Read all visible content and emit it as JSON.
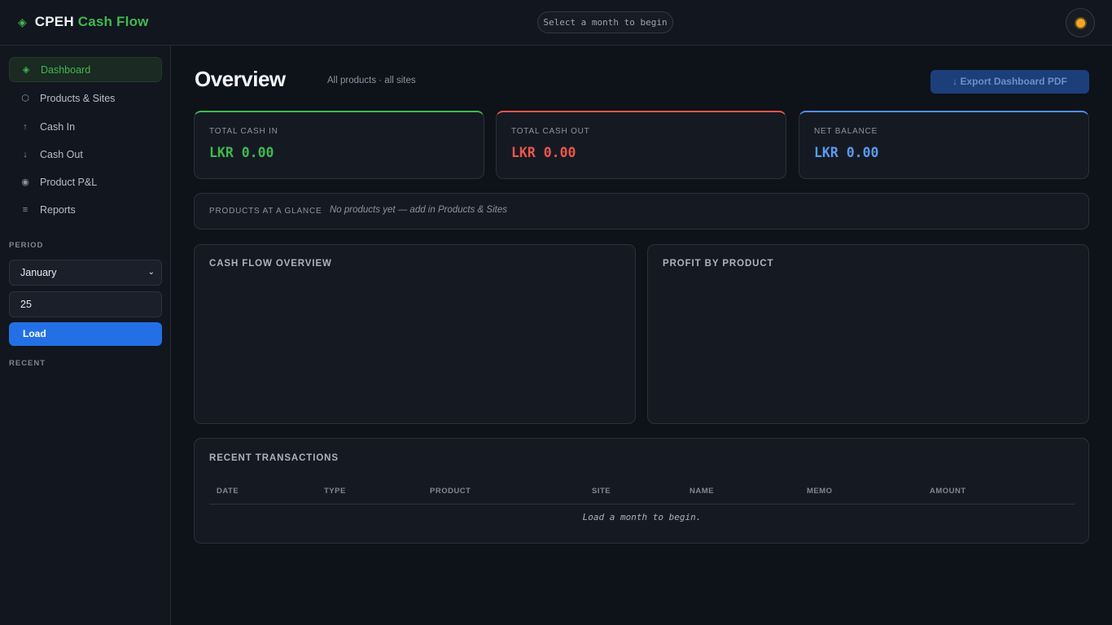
{
  "app": {
    "brand_part1": "CPEH",
    "brand_part2": "Cash Flow",
    "month_prompt": "Select a month to begin"
  },
  "sidebar": {
    "items": [
      {
        "label": "Dashboard",
        "icon": "diamond-icon",
        "active": true
      },
      {
        "label": "Products & Sites",
        "icon": "hexagon-icon"
      },
      {
        "label": "Cash In",
        "icon": "arrow-up-icon"
      },
      {
        "label": "Cash Out",
        "icon": "arrow-down-icon"
      },
      {
        "label": "Product P&L",
        "icon": "target-icon"
      },
      {
        "label": "Reports",
        "icon": "list-icon"
      }
    ],
    "period_label": "PERIOD",
    "month_value": "January",
    "year_value": "25",
    "load_label": "Load",
    "recent_label": "RECENT"
  },
  "main": {
    "title": "Overview",
    "subtitle": "All products · all sites",
    "export_label": "↓ Export Dashboard PDF",
    "stats": {
      "cash_in_label": "TOTAL CASH IN",
      "cash_in_value": "LKR 0.00",
      "cash_out_label": "TOTAL CASH OUT",
      "cash_out_value": "LKR 0.00",
      "net_label": "NET BALANCE",
      "net_value": "LKR 0.00"
    },
    "glance": {
      "label": "PRODUCTS AT A GLANCE",
      "text": "No products yet — add in Products & Sites"
    },
    "chart_cashflow_title": "CASH FLOW OVERVIEW",
    "chart_profit_title": "PROFIT BY PRODUCT",
    "recent": {
      "title": "RECENT TRANSACTIONS",
      "columns": [
        "DATE",
        "TYPE",
        "PRODUCT",
        "SITE",
        "NAME",
        "MEMO",
        "AMOUNT"
      ],
      "empty_text": "Load a month to begin."
    }
  },
  "colors": {
    "accent_green": "#3fb950",
    "accent_red": "#f0554a",
    "accent_blue": "#5a9af0",
    "primary_button": "#2370e6"
  }
}
